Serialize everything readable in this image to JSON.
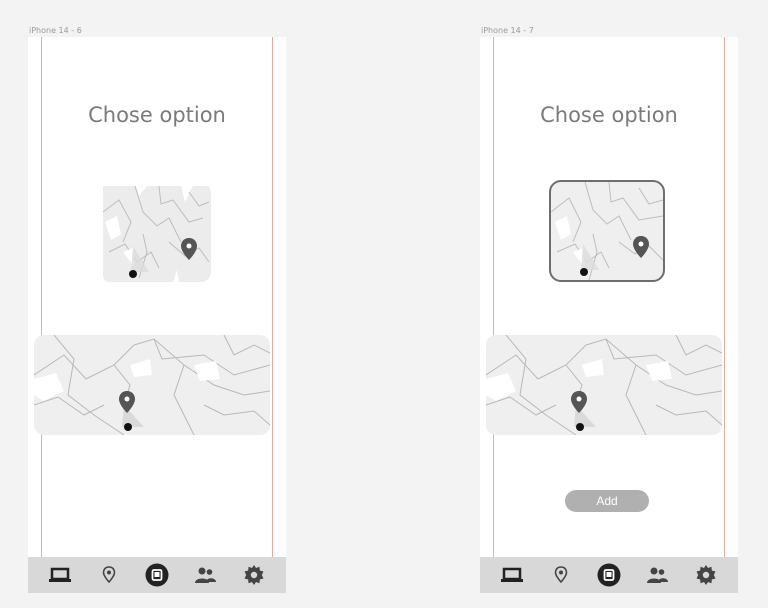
{
  "frames": [
    {
      "label": "iPhone 14 - 6",
      "title": "Chose option"
    },
    {
      "label": "iPhone 14 - 7",
      "title": "Chose option",
      "add_button": "Add"
    }
  ],
  "tabbar": {
    "icons": [
      "laptop-icon",
      "location-pin-icon",
      "home-square-icon",
      "users-icon",
      "settings-gear-icon"
    ]
  },
  "colors": {
    "background": "#f3f3f3",
    "phone": "#ffffff",
    "guides": "#f0a8a0",
    "tabbar": "#d8d8d8",
    "button": "#b0b0b0",
    "map": "#efefef"
  }
}
